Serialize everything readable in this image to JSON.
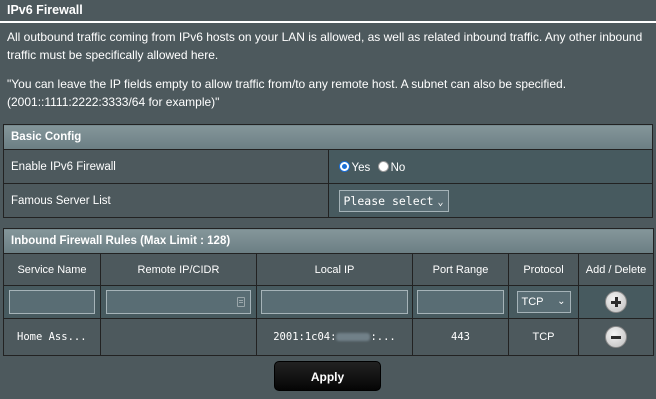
{
  "page": {
    "title": "IPv6 Firewall",
    "description": "All outbound traffic coming from IPv6 hosts on your LAN is allowed, as well as related inbound traffic. Any other inbound traffic must be specifically allowed here.",
    "note": "\"You can leave the IP fields empty to allow traffic from/to any remote host. A subnet can also be specified. (2001::1111:2222:3333/64 for example)\""
  },
  "basic_config": {
    "header": "Basic Config",
    "enable_label": "Enable IPv6 Firewall",
    "enable_options": [
      "Yes",
      "No"
    ],
    "enable_selected": "Yes",
    "server_list_label": "Famous Server List",
    "server_list_value": "Please select"
  },
  "rules": {
    "header": "Inbound Firewall Rules (Max Limit : 128)",
    "columns": [
      "Service Name",
      "Remote IP/CIDR",
      "Local IP",
      "Port Range",
      "Protocol",
      "Add / Delete"
    ],
    "new_protocol": "TCP",
    "entries": [
      {
        "service_name": "Home Ass...",
        "remote_ip": "",
        "local_ip_prefix": "2001:1c04:",
        "local_ip_suffix": ":...",
        "port_range": "443",
        "protocol": "TCP"
      }
    ]
  },
  "apply_label": "Apply",
  "icons": {
    "add": "plus-circle-icon",
    "delete": "minus-circle-icon",
    "dropdown": "chevron-down-icon"
  }
}
